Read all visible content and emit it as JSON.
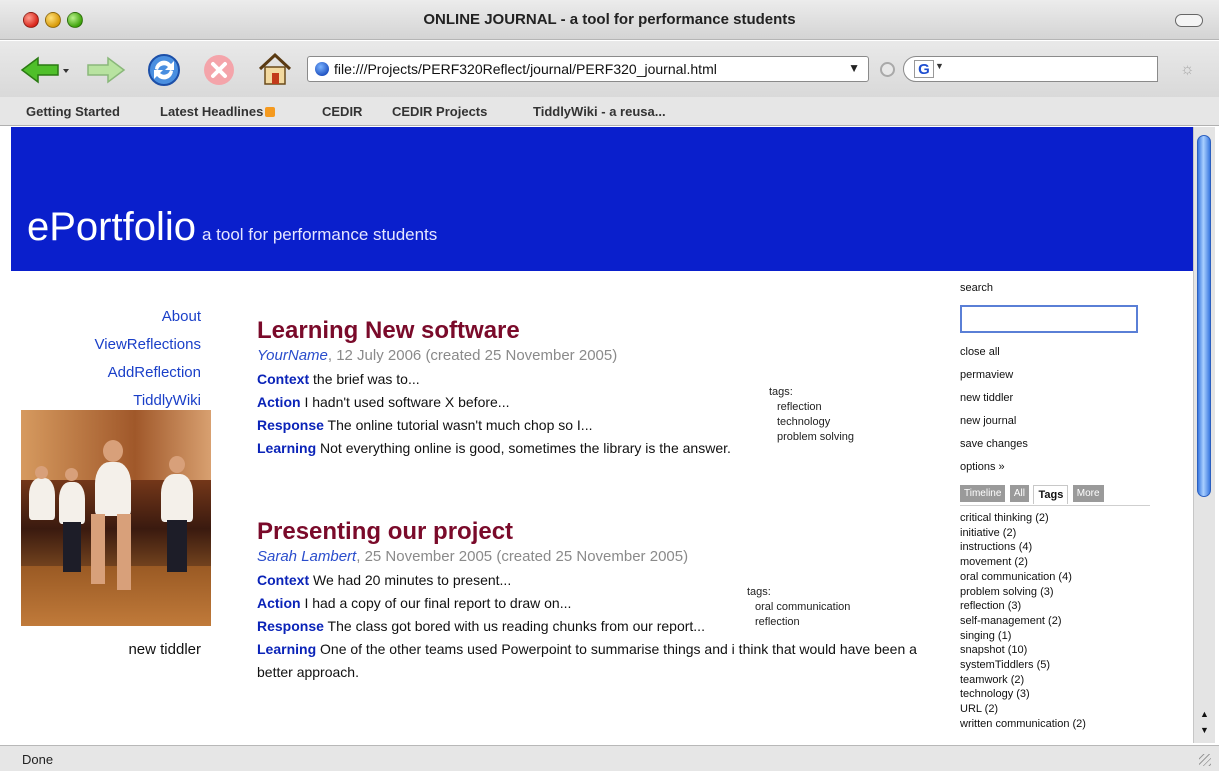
{
  "window": {
    "title": "ONLINE JOURNAL - a tool for performance students"
  },
  "toolbar": {
    "url": "file:///Projects/PERF320Reflect/journal/PERF320_journal.html",
    "search_engine": "G"
  },
  "bookmarks": [
    "Getting Started",
    "Latest Headlines",
    "CEDIR",
    "CEDIR Projects",
    "TiddlyWiki - a reusa..."
  ],
  "site": {
    "title": "ePortfolio",
    "subtitle": "a tool for performance students"
  },
  "main_menu": [
    "About",
    "ViewReflections",
    "AddReflection",
    "TiddlyWiki"
  ],
  "left_new_tiddler": "new tiddler",
  "tiddlers": [
    {
      "title": "Learning New software",
      "author": "YourName",
      "date_line": ", 12 July 2006 (created 25 November 2005)",
      "lines": [
        {
          "label": "Context",
          "text": " the brief was to..."
        },
        {
          "label": "Action",
          "text": " I hadn't used software X before..."
        },
        {
          "label": "Response",
          "text": " The online tutorial wasn't much chop so I..."
        },
        {
          "label": "Learning",
          "text": " Not everything online is good, sometimes the library is the answer."
        }
      ],
      "tags_label": "tags:",
      "tags": [
        "reflection",
        "technology",
        "problem solving"
      ]
    },
    {
      "title": "Presenting our project",
      "author": "Sarah Lambert",
      "date_line": ", 25 November 2005 (created 25 November 2005)",
      "lines": [
        {
          "label": "Context",
          "text": " We had 20 minutes to present..."
        },
        {
          "label": "Action",
          "text": " I had a copy of our final report to draw on..."
        },
        {
          "label": "Response",
          "text": " The class got bored with us reading chunks from our report..."
        },
        {
          "label": "Learning",
          "text": " One of the other teams used Powerpoint to summarise things and i think that would have been a better approach."
        }
      ],
      "tags_label": "tags:",
      "tags": [
        "oral communication",
        "reflection"
      ]
    }
  ],
  "sidebar": {
    "search_label": "search",
    "commands": [
      "close all",
      "permaview",
      "new tiddler",
      "new journal",
      "save changes",
      "options »"
    ],
    "tabs": [
      "Timeline",
      "All",
      "Tags",
      "More"
    ],
    "active_tab": "Tags",
    "tag_list": [
      "critical thinking (2)",
      "initiative (2)",
      "instructions (4)",
      "movement (2)",
      "oral communication (4)",
      "problem solving (3)",
      "reflection (3)",
      "self-management (2)",
      "singing (1)",
      "snapshot (10)",
      "systemTiddlers (5)",
      "teamwork (2)",
      "technology (3)",
      "URL (2)",
      "written communication (2)"
    ]
  },
  "status": {
    "text": "Done"
  },
  "colors": {
    "header_blue": "#0a1fcc",
    "title_maroon": "#7a0a2a",
    "link_blue": "#1a3fc8"
  }
}
